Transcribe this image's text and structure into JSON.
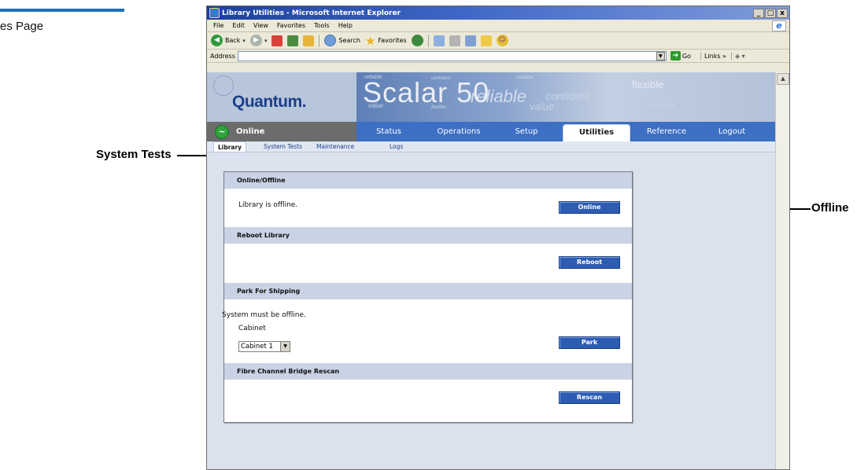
{
  "manual": {
    "heading_fragment": "es Page",
    "callout_left": "System Tests",
    "callout_right": "Offline"
  },
  "window": {
    "title": "Library Utilities - Microsoft Internet Explorer",
    "controls": [
      "_",
      "□",
      "x"
    ]
  },
  "menubar": {
    "items": [
      "File",
      "Edit",
      "View",
      "Favorites",
      "Tools",
      "Help"
    ]
  },
  "toolbar": {
    "back_label": "Back",
    "search_label": "Search",
    "favorites_label": "Favorites"
  },
  "addressbar": {
    "label": "Address",
    "value": "",
    "go_label": "Go",
    "links_label": "Links »"
  },
  "app": {
    "logo_text": "Quantum.",
    "product_name": "Scalar 50",
    "banner_words": [
      "reliable",
      "confident",
      "flexible",
      "value",
      "scalable",
      "reliable",
      "flexible",
      "confident",
      "value",
      "scalable",
      "reliable",
      "flexible"
    ],
    "status_label": "Online",
    "nav_tabs": [
      "Status",
      "Operations",
      "Setup",
      "Utilities",
      "Reference",
      "Logout"
    ],
    "active_tab": "Utilities",
    "sub_tabs": [
      "Library",
      "System Tests",
      "Maintenance",
      "Logs"
    ],
    "active_sub_tab": "Library"
  },
  "sections": {
    "online_offline": {
      "header": "Online/Offline",
      "text": "Library is offline.",
      "button": "Online"
    },
    "reboot": {
      "header": "Reboot Library",
      "button": "Reboot"
    },
    "park": {
      "header": "Park For Shipping",
      "text": "System must be offline.",
      "cabinet_label": "Cabinet",
      "cabinet_value": "Cabinet 1",
      "button": "Park"
    },
    "rescan": {
      "header": "Fibre Channel Bridge Rescan",
      "button": "Rescan"
    }
  },
  "colors": {
    "nav_blue": "#3d6fc4",
    "button_blue": "#2c5cb3",
    "status_green": "#2fa33c",
    "section_header": "#c9d3e5"
  },
  "icons": [
    "window-icon",
    "ie-logo-icon",
    "back-icon",
    "forward-icon",
    "stop-icon",
    "refresh-icon",
    "home-icon",
    "search-icon",
    "favorites-icon",
    "history-icon",
    "mail-icon",
    "print-icon",
    "edit-icon",
    "folder-icon",
    "messenger-icon",
    "go-icon",
    "online-status-icon",
    "dropdown-arrow-icon"
  ]
}
